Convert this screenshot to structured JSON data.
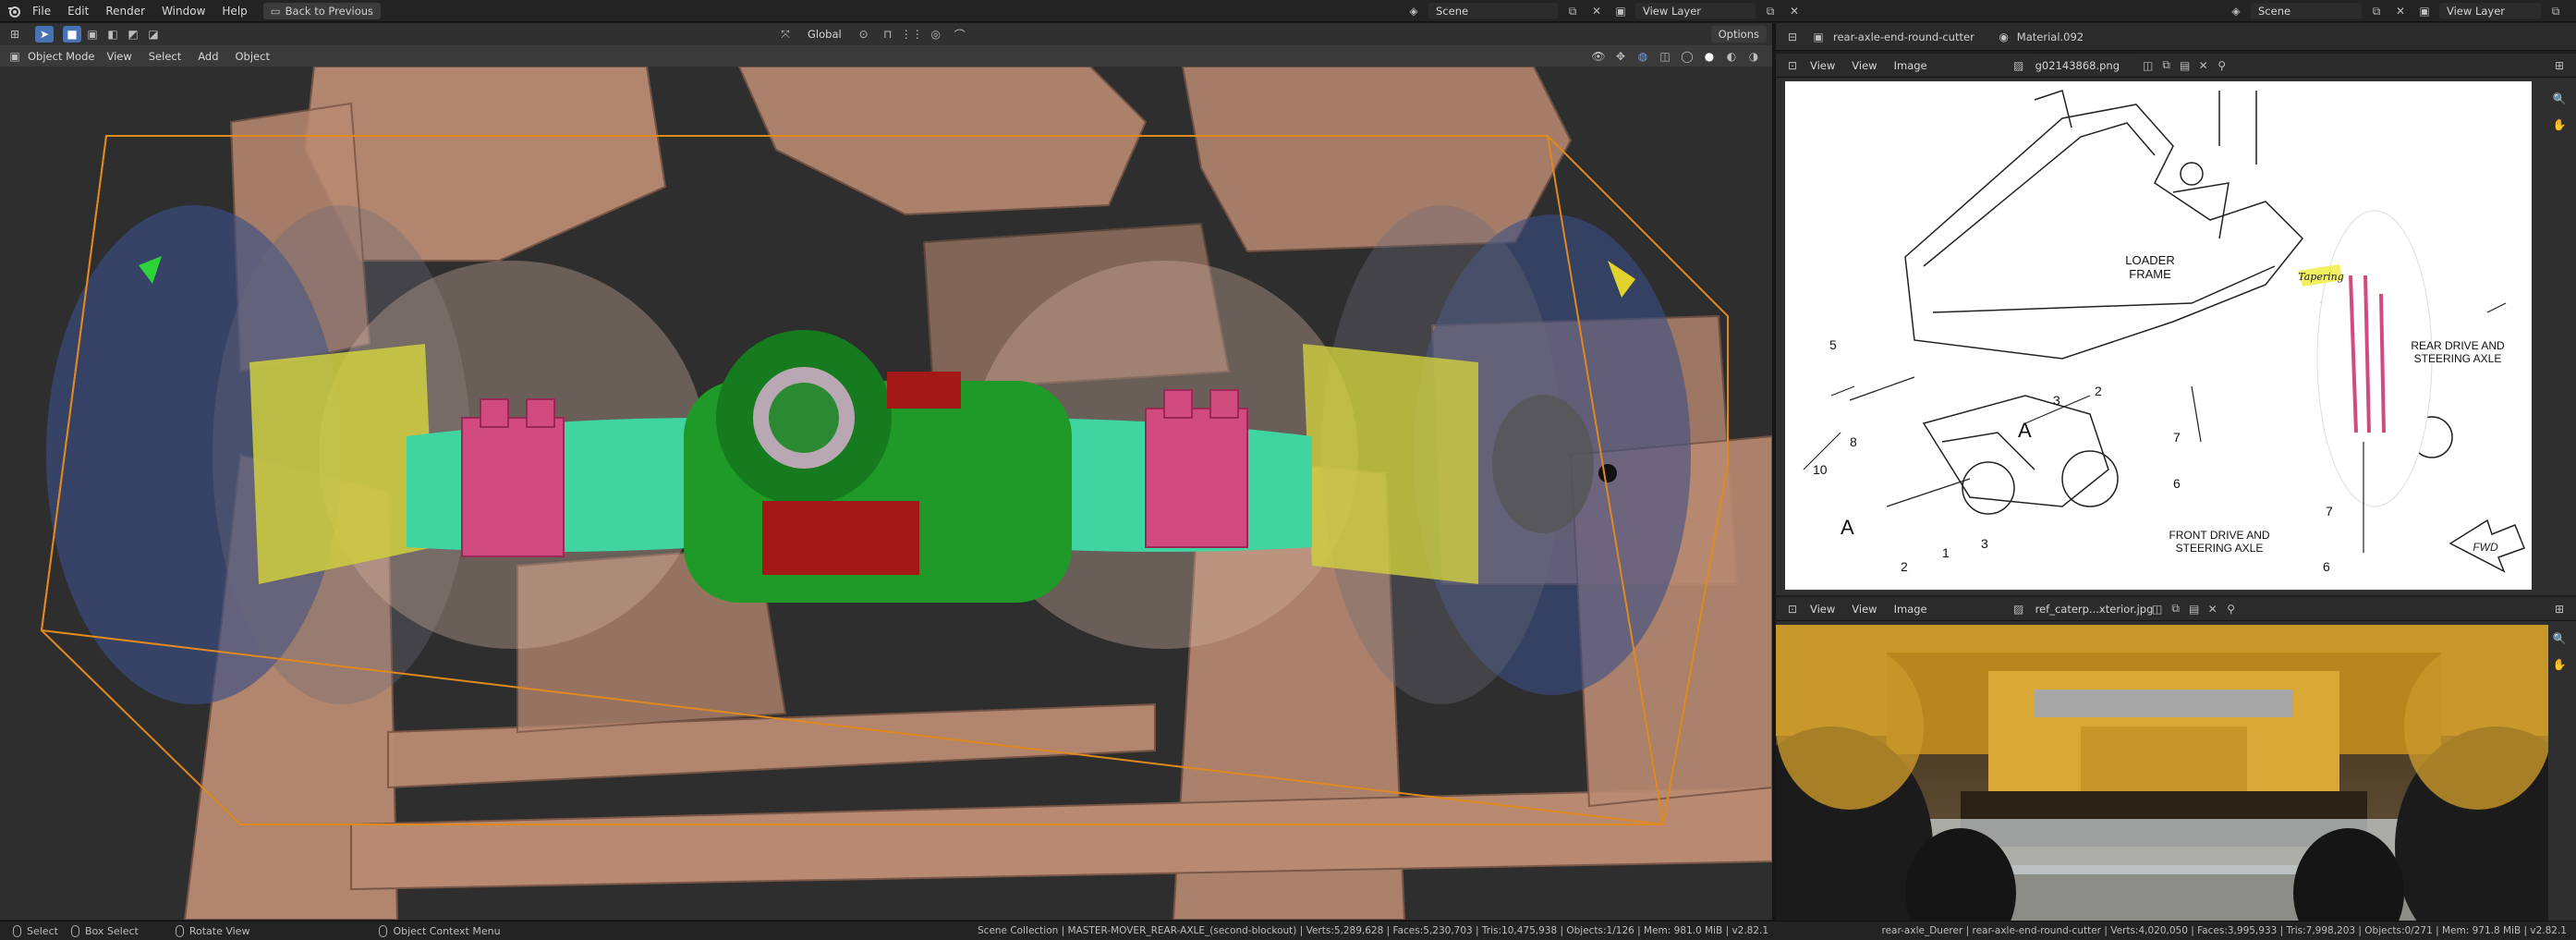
{
  "topbar": {
    "menus": [
      "File",
      "Edit",
      "Render",
      "Window",
      "Help"
    ],
    "back_button": "Back to Previous",
    "left_scene": "Scene",
    "left_view_layer": "View Layer",
    "right_scene": "Scene",
    "right_view_layer": "View Layer"
  },
  "viewport": {
    "header": {
      "transform_orientation": "Global",
      "options_label": "Options",
      "mode": "Object Mode",
      "menus": [
        "View",
        "Select",
        "Add",
        "Object"
      ]
    }
  },
  "properties_header": {
    "object_name": "rear-axle-end-round-cutter",
    "material_name": "Material.092"
  },
  "image_editor_top": {
    "menus": [
      "View",
      "View",
      "Image"
    ],
    "image_name": "g02143868.png",
    "diagram": {
      "loader_frame": "LOADER\nFRAME",
      "rear_axle": "REAR DRIVE AND\nSTEERING AXLE",
      "front_axle": "FRONT DRIVE AND\nSTEERING AXLE",
      "annotation": "Tapering",
      "fwd": "FWD",
      "numbers": [
        "5",
        "8",
        "10",
        "3",
        "2",
        "A",
        "7",
        "6",
        "A",
        "2",
        "1",
        "3",
        "7",
        "6"
      ]
    }
  },
  "image_editor_bottom": {
    "menus": [
      "View",
      "View",
      "Image"
    ],
    "image_name": "ref_caterp...xterior.jpg"
  },
  "statusbar": {
    "select": "Select",
    "box_select": "Box Select",
    "rotate_view": "Rotate View",
    "context_menu": "Object Context Menu",
    "stats_left": "Scene Collection | MASTER-MOVER_REAR-AXLE_(second-blockout) | Verts:5,289,628 | Faces:5,230,703 | Tris:10,475,938 | Objects:1/126 | Mem: 981.0 MiB | v2.82.1",
    "stats_right": "rear-axle_Duerer | rear-axle-end-round-cutter | Verts:4,020,050 | Faces:3,995,933 | Tris:7,998,203 | Objects:0/271 | Mem: 971.8 MiB | v2.82.1"
  },
  "colors": {
    "accent": "#4772b3",
    "selection_outline": "#e0891e",
    "frame": "#b98a72",
    "axle_green": "#1f9a28",
    "axle_pink": "#d24b7f",
    "axle_teal": "#3fd4a0",
    "hub_yellow": "#cfcf3f",
    "wheel_blue": "#3a4e86"
  }
}
